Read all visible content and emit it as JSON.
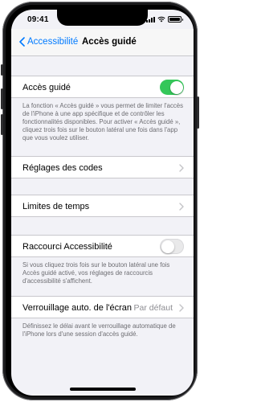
{
  "status": {
    "time": "09:41"
  },
  "nav": {
    "back_label": "Accessibilité",
    "title": "Accès guidé"
  },
  "guided_access": {
    "label": "Accès guidé",
    "enabled": true,
    "footer": "La fonction « Accès guidé » vous permet de limiter l'accès de l'iPhone à une app spécifique et de contrôler les fonctionnalités disponibles. Pour activer « Accès guidé », cliquez trois fois sur le bouton latéral une fois dans l'app que vous voulez utiliser."
  },
  "passcode": {
    "label": "Réglages des codes"
  },
  "time_limits": {
    "label": "Limites de temps"
  },
  "shortcut": {
    "label": "Raccourci Accessibilité",
    "enabled": false,
    "footer": "Si vous cliquez trois fois sur le bouton latéral une fois Accès guidé activé, vos réglages de raccourcis d'accessibilité s'affichent."
  },
  "autolock": {
    "label": "Verrouillage auto. de l'écran",
    "value": "Par défaut",
    "footer": "Définissez le délai avant le verrouillage automatique de l'iPhone lors d'une session d'accès guidé."
  },
  "colors": {
    "accent": "#007aff",
    "toggle_on": "#34c759",
    "background": "#f2f2f7"
  }
}
